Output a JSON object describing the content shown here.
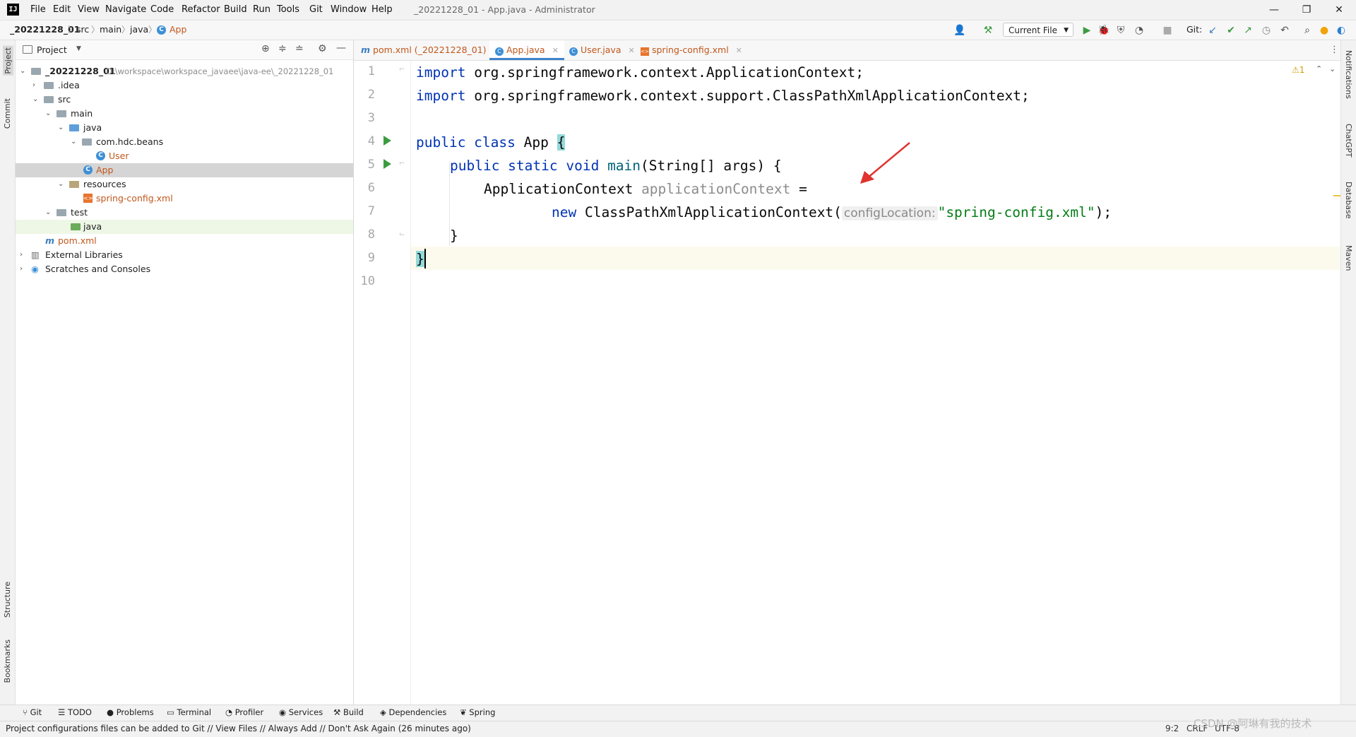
{
  "window": {
    "title": "_20221228_01 - App.java - Administrator",
    "logo": "IJ",
    "menu": [
      "File",
      "Edit",
      "View",
      "Navigate",
      "Code",
      "Refactor",
      "Build",
      "Run",
      "Tools",
      "Git",
      "Window",
      "Help"
    ]
  },
  "breadcrumb": [
    "_20221228_01",
    "src",
    "main",
    "java",
    "App"
  ],
  "toolbar": {
    "run_config": "Current File",
    "git_label": "Git:"
  },
  "project_panel": {
    "title": "Project",
    "tree": [
      {
        "label": "_20221228_01",
        "path": "D:\\workspace\\workspace_javaee\\java-ee\\_20221228_01",
        "depth": 0,
        "expanded": true,
        "icon": "module-folder"
      },
      {
        "label": ".idea",
        "depth": 1,
        "expanded": false,
        "icon": "folder"
      },
      {
        "label": "src",
        "depth": 1,
        "expanded": true,
        "icon": "folder"
      },
      {
        "label": "main",
        "depth": 2,
        "expanded": true,
        "icon": "folder"
      },
      {
        "label": "java",
        "depth": 3,
        "expanded": true,
        "icon": "source-folder"
      },
      {
        "label": "com.hdc.beans",
        "depth": 4,
        "expanded": true,
        "icon": "package"
      },
      {
        "label": "User",
        "depth": 5,
        "icon": "class"
      },
      {
        "label": "App",
        "depth": 4,
        "icon": "class",
        "selected": true
      },
      {
        "label": "resources",
        "depth": 3,
        "expanded": true,
        "icon": "resources-folder"
      },
      {
        "label": "spring-config.xml",
        "depth": 4,
        "icon": "xml"
      },
      {
        "label": "test",
        "depth": 2,
        "expanded": true,
        "icon": "folder"
      },
      {
        "label": "java",
        "depth": 3,
        "icon": "test-folder",
        "highlighted": true
      },
      {
        "label": "pom.xml",
        "depth": 1,
        "icon": "maven"
      },
      {
        "label": "External Libraries",
        "depth": 0,
        "expanded": false,
        "icon": "libraries"
      },
      {
        "label": "Scratches and Consoles",
        "depth": 0,
        "expanded": false,
        "icon": "scratches"
      }
    ]
  },
  "editor": {
    "tabs": [
      {
        "label": "pom.xml (_20221228_01)",
        "icon": "maven"
      },
      {
        "label": "App.java",
        "icon": "class",
        "active": true
      },
      {
        "label": "User.java",
        "icon": "class"
      },
      {
        "label": "spring-config.xml",
        "icon": "xml"
      }
    ],
    "line_numbers": [
      "1",
      "2",
      "3",
      "4",
      "5",
      "6",
      "7",
      "8",
      "9",
      "10"
    ],
    "code": {
      "l1_kw": "import",
      "l1_rest": " org.springframework.context.ApplicationContext;",
      "l2_kw": "import",
      "l2_rest": " org.springframework.context.support.ClassPathXmlApplicationContext;",
      "l4_kw": "public class",
      "l4_name": " App ",
      "l4_brace": "{",
      "l5_kw": "public static void",
      "l5_fn": " main",
      "l5_rest": "(String[] args) {",
      "l6_type": "ApplicationContext ",
      "l6_var": "applicationContext",
      "l6_eq": " =",
      "l7_kw": "new",
      "l7_cls": " ClassPathXmlApplicationContext(",
      "l7_hint": "configLocation:",
      "l7_str": "\"spring-config.xml\"",
      "l7_end": ");",
      "l8": "}",
      "l9": "}"
    },
    "warnings": "⚠1"
  },
  "right_tools": [
    "Notifications",
    "ChatGPT",
    "Database",
    "Maven"
  ],
  "left_tools": [
    "Project",
    "Commit",
    "Structure",
    "Bookmarks"
  ],
  "bottom_tools": [
    "Git",
    "TODO",
    "Problems",
    "Terminal",
    "Profiler",
    "Services",
    "Build",
    "Dependencies",
    "Spring"
  ],
  "status": {
    "message": "Project configurations files can be added to Git // View Files // Always Add // Don't Ask Again (26 minutes ago)",
    "position": "9:2",
    "line_sep": "CRLF",
    "encoding": "UTF-8",
    "watermark": "CSDN @阿琳有我的技术"
  },
  "colors": {
    "keyword": "#0033b3",
    "string": "#067d17",
    "selected_row": "#d5d5d5",
    "run_marker": "#3c9b41",
    "annotation_arrow": "#e0342f"
  }
}
